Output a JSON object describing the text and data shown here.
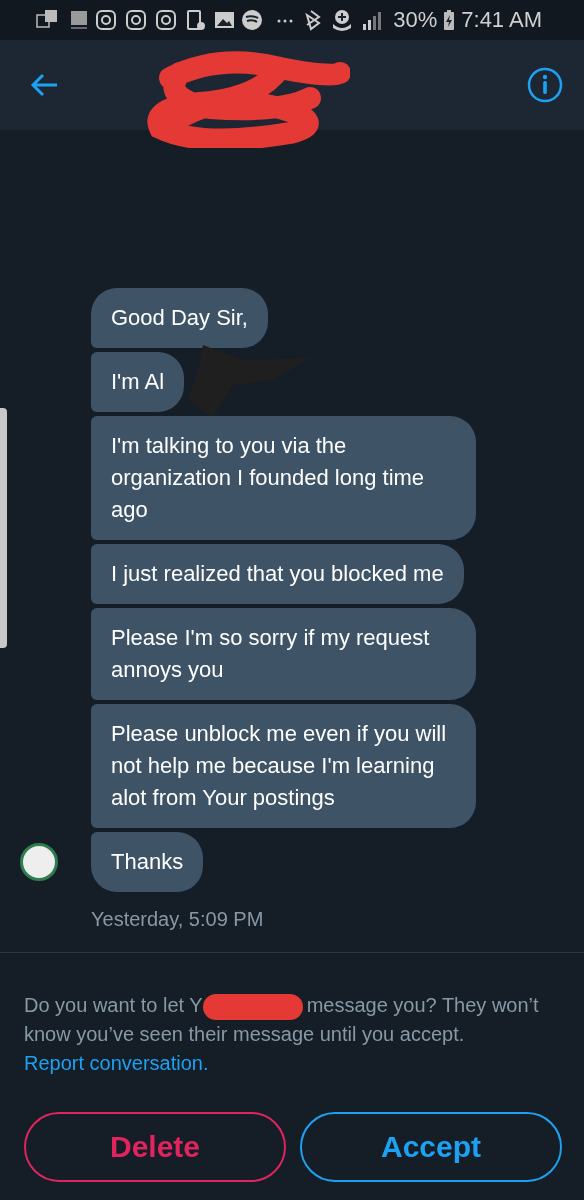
{
  "status_bar": {
    "battery": "30%",
    "time": "7:41 AM"
  },
  "messages": [
    {
      "text": "Good Day Sir,",
      "redacted": false
    },
    {
      "text": "I'm Al",
      "redacted": true
    },
    {
      "text": "I'm talking to you via the organization I founded long time ago",
      "redacted": false
    },
    {
      "text": "I just realized that you blocked me",
      "redacted": false
    },
    {
      "text": "Please I'm so sorry if my request annoys you",
      "redacted": false
    },
    {
      "text": "Please unblock me even if you will not help me because I'm learning alot from Your postings",
      "redacted": false
    },
    {
      "text": "Thanks",
      "redacted": false
    }
  ],
  "timestamp": "Yesterday, 5:09 PM",
  "request": {
    "before": "Do you want to let Y",
    "after": "message you? They won’t know you’ve seen their message until you accept.",
    "link": "Report conversation."
  },
  "buttons": [
    {
      "label": "Delete",
      "kind": "danger"
    },
    {
      "label": "Accept",
      "kind": "primary"
    }
  ]
}
